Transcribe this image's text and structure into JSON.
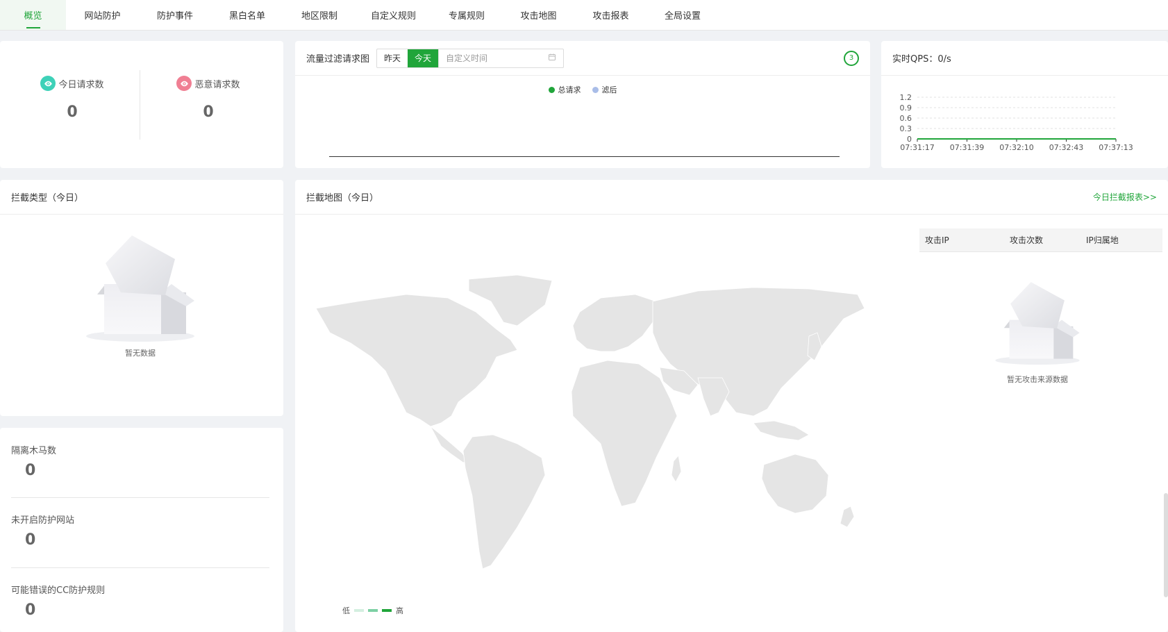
{
  "nav": {
    "tabs": [
      {
        "label": "概览",
        "active": true
      },
      {
        "label": "网站防护",
        "active": false
      },
      {
        "label": "防护事件",
        "active": false
      },
      {
        "label": "黑白名单",
        "active": false
      },
      {
        "label": "地区限制",
        "active": false
      },
      {
        "label": "自定义规则",
        "active": false
      },
      {
        "label": "专属规则",
        "active": false
      },
      {
        "label": "攻击地图",
        "active": false
      },
      {
        "label": "攻击报表",
        "active": false
      },
      {
        "label": "全局设置",
        "active": false
      }
    ]
  },
  "requests": {
    "today_label": "今日请求数",
    "today_value": "0",
    "malicious_label": "恶意请求数",
    "malicious_value": "0",
    "today_icon": "eye-icon",
    "malicious_icon": "eye-icon",
    "today_color": "#3ed1b8",
    "malicious_color": "#f07f93"
  },
  "traffic": {
    "title": "流量过滤请求图",
    "btn_yesterday": "昨天",
    "btn_today": "今天",
    "custom_time_placeholder": "自定义时间",
    "count_badge": "3",
    "legend_total": "总请求",
    "legend_filtered": "滤后",
    "total_color": "#20a53a",
    "filtered_color": "#a9bde8"
  },
  "qps": {
    "title": "实时QPS：0/s",
    "chart_data": {
      "type": "line",
      "x": [
        "07:31:17",
        "07:31:39",
        "07:32:10",
        "07:32:43",
        "07:37:13"
      ],
      "series": [
        {
          "values": [
            0,
            0,
            0,
            0,
            0
          ]
        }
      ],
      "y_ticks": [
        "0",
        "0.3",
        "0.6",
        "0.9",
        "1.2"
      ],
      "ylim": [
        0,
        1.2
      ],
      "grid": true,
      "line_color": "#20a53a"
    }
  },
  "block_type": {
    "title": "拦截类型（今日）",
    "empty_text": "暂无数据"
  },
  "map": {
    "title": "拦截地图（今日）",
    "report_link": "今日拦截报表>>",
    "table_headers": [
      "攻击IP",
      "攻击次数",
      "IP归属地"
    ],
    "empty_text": "暂无攻击来源数据",
    "scale_low": "低",
    "scale_high": "高",
    "scale_colors": [
      "#d4efe0",
      "#7dd0a4",
      "#20a53a"
    ]
  },
  "misc": {
    "quarantine_label": "隔离木马数",
    "quarantine_value": "0",
    "unprotected_label": "未开启防护网站",
    "unprotected_value": "0",
    "cc_label": "可能错误的CC防护规则",
    "cc_value": "0"
  }
}
